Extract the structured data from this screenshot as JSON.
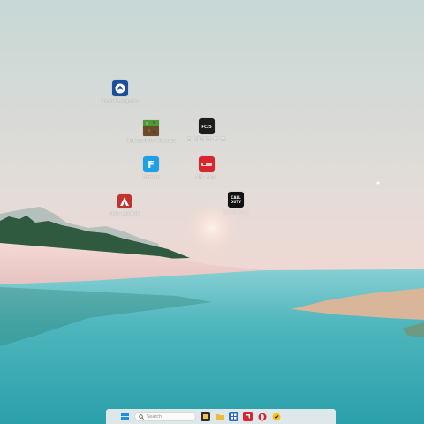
{
  "desktop_icons": [
    {
      "id": "rocket-league",
      "label": "Rocket League®",
      "icon": "rocket-league-icon"
    },
    {
      "id": "minecraft",
      "label": "Minecraft for Windows",
      "icon": "minecraft-icon"
    },
    {
      "id": "ea-sports-fc",
      "label": "EA SPORTS FC 25",
      "icon": "ea-sports-fc-icon"
    },
    {
      "id": "fortnite",
      "label": "Fortnite",
      "icon": "fortnite-icon"
    },
    {
      "id": "nba-2k",
      "label": "NBA 2K24",
      "icon": "nba-2k-icon"
    },
    {
      "id": "apex-legends",
      "label": "Apex Legends",
      "icon": "apex-legends-icon"
    },
    {
      "id": "call-of-duty",
      "label": "Call of Duty",
      "icon": "call-of-duty-icon"
    }
  ],
  "icon_glyphs": {
    "fortnite": "F",
    "ea_sports_fc": "FC25",
    "call_of_duty_line1": "CALL",
    "call_of_duty_line2": "DUTY"
  },
  "taskbar": {
    "search_placeholder": "Search",
    "items": [
      "start-icon",
      "search-icon",
      "widget-icon",
      "file-explorer-icon",
      "store-icon",
      "amd-software-icon",
      "opera-browser-icon",
      "norton-icon"
    ]
  },
  "colors": {
    "sky_top": "#cfdcd9",
    "sky_bottom": "#f1d8d3",
    "water": "#3fb0b6",
    "taskbar": "#eeeeef",
    "amd_red": "#d7262f",
    "fortnite_blue": "#1da1e6"
  }
}
